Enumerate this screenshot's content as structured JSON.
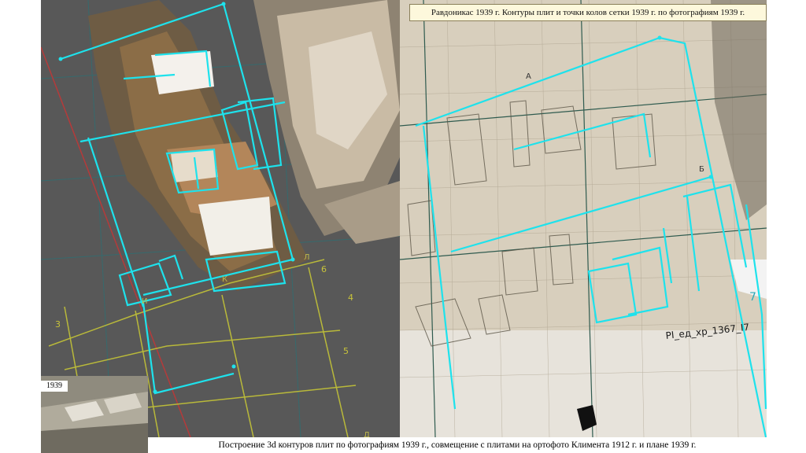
{
  "title": "Равдоникас 1939 г. Контуры плит и точки колов сетки 1939 г. по фотографиям 1939 г.",
  "caption": "Построение 3d контуров плит по фотографиям 1939 г., совмещение с плитами на ортофото Климента 1912 г. и плане 1939 г.",
  "inset_label": "1939",
  "plan_label": "PI_ед_хр_1367_I7",
  "left_grid_numbers": [
    "3",
    "4",
    "5",
    "6"
  ],
  "left_cyrillic_labels": [
    "Л",
    "К",
    "И",
    "Д"
  ],
  "right_grid_number": "7",
  "right_cyrillic_labels": [
    "А",
    "Б"
  ],
  "colors": {
    "contour": "#1ee2ec",
    "grid": "#b9b93a",
    "left_background": "#585858",
    "plan_paper": "#d9d2c2"
  }
}
